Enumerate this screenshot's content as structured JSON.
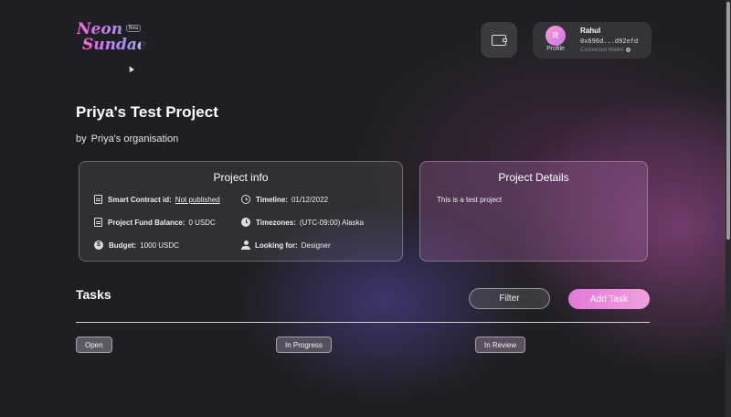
{
  "brand": {
    "logo_line1": "Neon",
    "logo_line2": "Sundae",
    "badge": "Beta"
  },
  "header": {
    "wallet_icon": "wallet-icon",
    "profile": {
      "avatar_initial": "R",
      "label": "Profile",
      "name": "Rahul",
      "address": "0x696d...d92efd",
      "status": "Connected Wallet"
    }
  },
  "project": {
    "title": "Priya's Test Project",
    "by_prefix": "by",
    "organisation": "Priya's organisation"
  },
  "project_info": {
    "heading": "Project info",
    "smart_contract": {
      "label": "Smart Contract id:",
      "value": "Not published"
    },
    "fund_balance": {
      "label": "Project Fund Balance:",
      "value": "0 USDC"
    },
    "budget": {
      "label": "Budget:",
      "value": "1000 USDC"
    },
    "timeline": {
      "label": "Timeline:",
      "value": "01/12/2022"
    },
    "timezones": {
      "label": "Timezones:",
      "value": "(UTC-09:00) Alaska"
    },
    "looking_for": {
      "label": "Looking for:",
      "value": "Designer"
    }
  },
  "project_details": {
    "heading": "Project Details",
    "description": "This is a test project"
  },
  "tasks": {
    "heading": "Tasks",
    "filter_label": "Filter",
    "add_label": "Add Task",
    "columns": [
      "Open",
      "In Progress",
      "In Review"
    ]
  },
  "colors": {
    "accent": "#e27ad8",
    "background": "#1f1f23"
  }
}
